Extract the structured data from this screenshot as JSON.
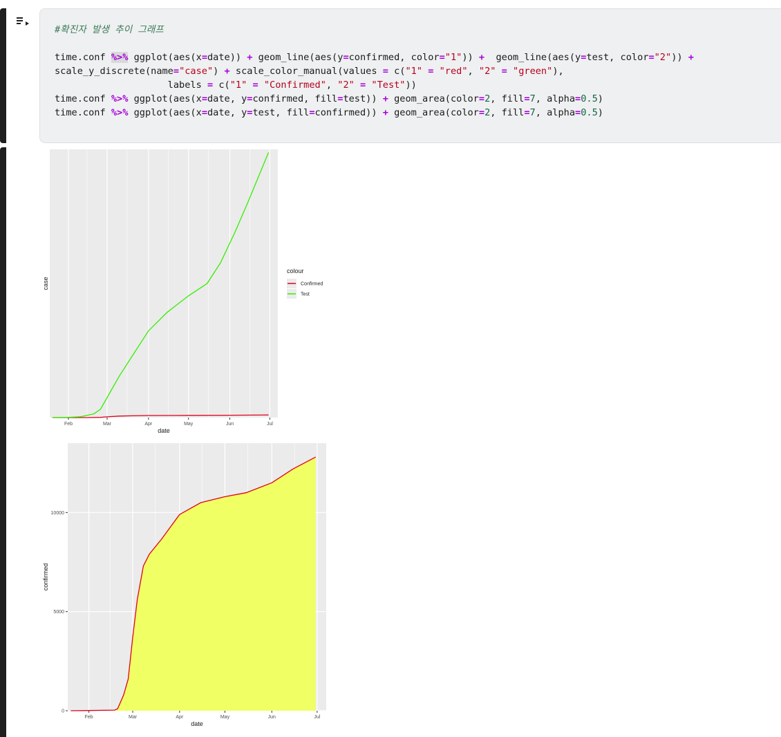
{
  "cell": {
    "comment": "#확진자 발생 추이 그래프",
    "code_lines": [
      "time.conf %>% ggplot(aes(x=date)) + geom_line(aes(y=confirmed, color=\"1\")) +  geom_line(aes(y=test, color=\"2\")) +",
      "scale_y_discrete(name=\"case\") + scale_color_manual(values = c(\"1\" = \"red\", \"2\" = \"green\"),",
      "                    labels = c(\"1\" = \"Confirmed\", \"2\" = \"Test\"))",
      "time.conf %>% ggplot(aes(x=date, y=confirmed, fill=test)) + geom_area(color=2, fill=7, alpha=0.5)",
      "time.conf %>% ggplot(aes(x=date, y=test, fill=confirmed)) + geom_area(color=2, fill=7, alpha=0.5)"
    ],
    "run_icon": "run-cell-icon"
  },
  "colors": {
    "panel_bg": "#ebebeb",
    "grid": "#ffffff",
    "confirmed_line": "#e0001b",
    "test_line": "#33ee00",
    "area_fill": "#f0ff63"
  },
  "chart_data": [
    {
      "type": "line",
      "xlabel": "date",
      "ylabel": "case",
      "x_ticks": [
        "Feb",
        "Mar",
        "Apr",
        "May",
        "Jun",
        "Jul"
      ],
      "y_ticks": [],
      "xlim": [
        "2020-01-20",
        "2020-06-30"
      ],
      "ylim": [
        0,
        1300000
      ],
      "grid": true,
      "legend": {
        "title": "colour",
        "placement": "right",
        "entries": [
          "Confirmed",
          "Test"
        ]
      },
      "series": [
        {
          "name": "Confirmed",
          "color": "red",
          "x": [
            "2020-01-20",
            "2020-02-01",
            "2020-02-15",
            "2020-02-25",
            "2020-03-01",
            "2020-03-10",
            "2020-03-20",
            "2020-04-01",
            "2020-05-01",
            "2020-06-01",
            "2020-06-30"
          ],
          "values": [
            1,
            11,
            28,
            1000,
            3700,
            7500,
            8650,
            9900,
            10800,
            11500,
            12800
          ]
        },
        {
          "name": "Test",
          "color": "green",
          "x": [
            "2020-01-20",
            "2020-02-01",
            "2020-02-10",
            "2020-02-20",
            "2020-02-25",
            "2020-03-01",
            "2020-03-10",
            "2020-03-20",
            "2020-04-01",
            "2020-04-15",
            "2020-05-01",
            "2020-05-15",
            "2020-05-25",
            "2020-06-05",
            "2020-06-15",
            "2020-06-30"
          ],
          "values": [
            0,
            1000,
            4000,
            18000,
            40000,
            97000,
            200000,
            300000,
            420000,
            510000,
            590000,
            650000,
            750000,
            900000,
            1050000,
            1285000
          ]
        }
      ]
    },
    {
      "type": "area",
      "xlabel": "date",
      "ylabel": "confirmed",
      "x_ticks": [
        "Feb",
        "Mar",
        "Apr",
        "May",
        "Jun",
        "Jul"
      ],
      "y_ticks": [
        0,
        5000,
        10000
      ],
      "xlim": [
        "2020-01-20",
        "2020-06-30"
      ],
      "ylim": [
        0,
        13500
      ],
      "grid": true,
      "x": [
        "2020-01-20",
        "2020-02-01",
        "2020-02-18",
        "2020-02-20",
        "2020-02-24",
        "2020-02-27",
        "2020-03-01",
        "2020-03-04",
        "2020-03-08",
        "2020-03-12",
        "2020-03-20",
        "2020-04-01",
        "2020-04-15",
        "2020-05-01",
        "2020-05-15",
        "2020-06-01",
        "2020-06-15",
        "2020-06-30"
      ],
      "values": [
        1,
        11,
        30,
        100,
        800,
        1600,
        3700,
        5600,
        7300,
        7900,
        8650,
        9900,
        10500,
        10800,
        11000,
        11500,
        12200,
        12800
      ]
    }
  ]
}
